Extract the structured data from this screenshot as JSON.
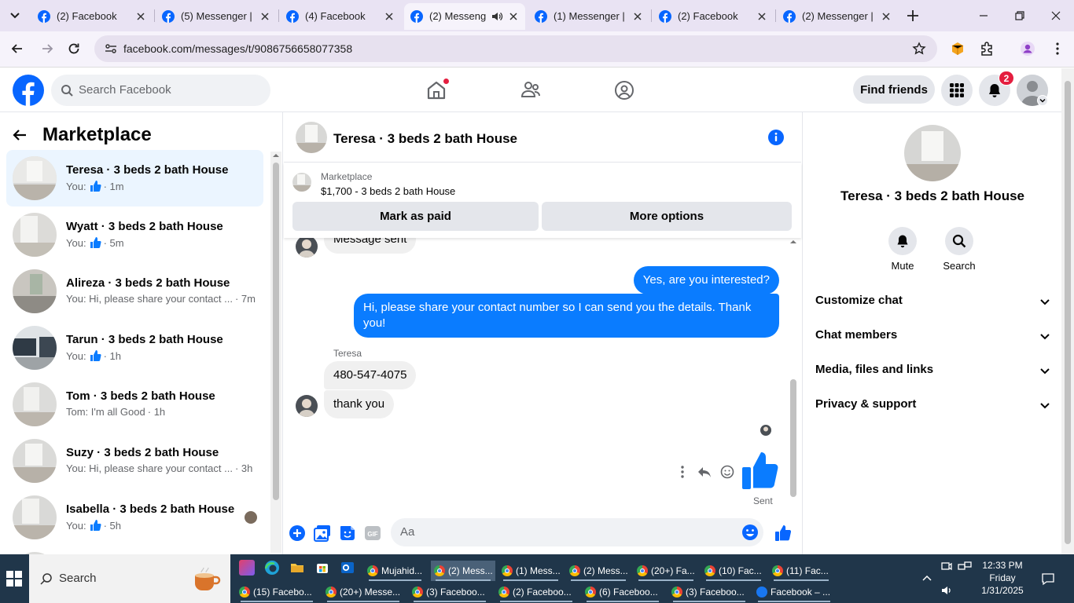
{
  "browser": {
    "tabs": [
      {
        "title": "(2) Facebook",
        "icon": "facebook-favicon",
        "active": false
      },
      {
        "title": "(5) Messenger |",
        "icon": "facebook-favicon",
        "active": false
      },
      {
        "title": "(4) Facebook",
        "icon": "facebook-favicon",
        "active": false
      },
      {
        "title": "(2) Messeng",
        "icon": "facebook-favicon",
        "active": true,
        "audio": true
      },
      {
        "title": "(1) Messenger |",
        "icon": "facebook-favicon",
        "active": false
      },
      {
        "title": "(2) Facebook",
        "icon": "facebook-favicon",
        "active": false
      },
      {
        "title": "(2) Messenger |",
        "icon": "facebook-favicon",
        "active": false
      }
    ],
    "url": "facebook.com/messages/t/9086756658077358"
  },
  "fb_header": {
    "search_placeholder": "Search Facebook",
    "find_friends": "Find friends",
    "notification_count": "2"
  },
  "left_pane": {
    "title": "Marketplace",
    "conversations": [
      {
        "name": "Teresa · 3 beds 2 bath House",
        "preview": "You:",
        "like": true,
        "time": "· 1m",
        "selected": true
      },
      {
        "name": "Wyatt · 3 beds 2 bath House",
        "preview": "You:",
        "like": true,
        "time": "· 5m",
        "selected": false
      },
      {
        "name": "Alireza · 3 beds 2 bath House",
        "preview": "You: Hi, please share your contact ...",
        "like": false,
        "time": "· 7m",
        "selected": false
      },
      {
        "name": "Tarun · 3 beds 2 bath House",
        "preview": "You:",
        "like": true,
        "time": "· 1h",
        "selected": false
      },
      {
        "name": "Tom · 3 beds 2 bath House",
        "preview": "Tom: I'm all Good",
        "like": false,
        "time": "· 1h",
        "selected": false
      },
      {
        "name": "Suzy · 3 beds 2 bath House",
        "preview": "You: Hi, please share your contact ...",
        "like": false,
        "time": "· 3h",
        "selected": false
      },
      {
        "name": "Isabella · 3 beds 2 bath House",
        "preview": "You:",
        "like": true,
        "time": "· 5h",
        "selected": false
      }
    ]
  },
  "chat": {
    "title": "Teresa · 3 beds 2 bath House",
    "marketplace_label": "Marketplace",
    "listing": "$1,700 - 3 beds 2 bath House",
    "mark_paid": "Mark as paid",
    "more_options": "More options",
    "messages": {
      "partial_in": "Message sent",
      "out_1": "Yes, are you interested?",
      "out_2": "Hi, please share your contact number so I can send you the details. Thank you!",
      "sender": "Teresa",
      "in_1": "480-547-4075",
      "in_2": "thank you",
      "status": "Sent"
    },
    "composer_placeholder": "Aa"
  },
  "right_pane": {
    "name": "Teresa · 3 beds 2 bath House",
    "actions": [
      {
        "label": "Mute",
        "icon": "bell-icon"
      },
      {
        "label": "Search",
        "icon": "search-icon"
      }
    ],
    "sections": [
      "Customize chat",
      "Chat members",
      "Media, files and links",
      "Privacy & support"
    ]
  },
  "taskbar": {
    "search_placeholder": "Search",
    "row1": [
      "Mujahid...",
      "(2) Mess...",
      "(1) Mess...",
      "(2) Mess...",
      "(20+) Fa...",
      "(10) Fac...",
      "(11) Fac..."
    ],
    "row2": [
      "(15) Facebo...",
      "(20+) Messe...",
      "(3) Faceboo...",
      "(2) Faceboo...",
      "(6) Faceboo...",
      "(3) Faceboo...",
      "Facebook – ..."
    ],
    "time": "12:33 PM",
    "day": "Friday",
    "date": "1/31/2025"
  },
  "colors": {
    "fb_blue": "#0866ff",
    "bubble_out": "#0a7cff",
    "badge_red": "#e41e3f"
  }
}
